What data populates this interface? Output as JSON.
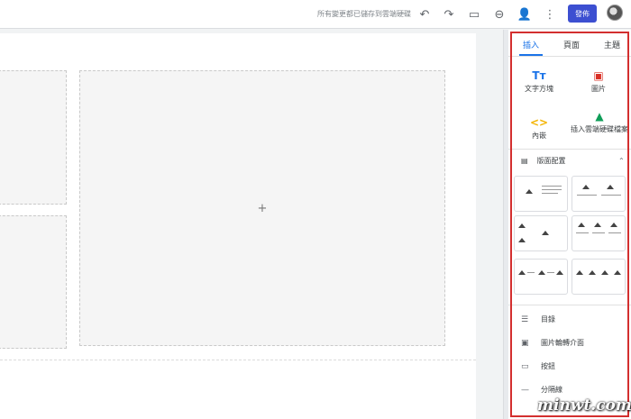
{
  "topbar": {
    "save_status": "所有變更都已儲存到雲端硬碟",
    "publish_label": "發佈",
    "icons": [
      "undo-icon",
      "redo-icon",
      "preview-icon",
      "link-icon",
      "share-icon",
      "more-icon"
    ]
  },
  "canvas": {
    "add_symbol": "+"
  },
  "panel": {
    "tabs": [
      "插入",
      "頁面",
      "主題"
    ],
    "insert": {
      "textbox": {
        "icon": "Tт",
        "label": "文字方塊"
      },
      "image": {
        "icon": "▣",
        "label": "圖片"
      },
      "embed": {
        "icon": "<>",
        "label": "內嵌"
      },
      "drive": {
        "icon": "▲",
        "label": "插入雲端硬碟檔案"
      }
    },
    "layouts": {
      "label": "版面配置",
      "collapse": "⌃"
    },
    "components": [
      {
        "icon": "☰",
        "label": "目錄"
      },
      {
        "icon": "▣",
        "label": "圖片輪轉介面"
      },
      {
        "icon": "▭",
        "label": "按鈕"
      },
      {
        "icon": "—",
        "label": "分隔線"
      }
    ]
  },
  "colors": {
    "accent": "#1a73e8",
    "publish": "#3c4fd1",
    "highlight": "#d32f2f"
  },
  "watermark": "minwt.com"
}
